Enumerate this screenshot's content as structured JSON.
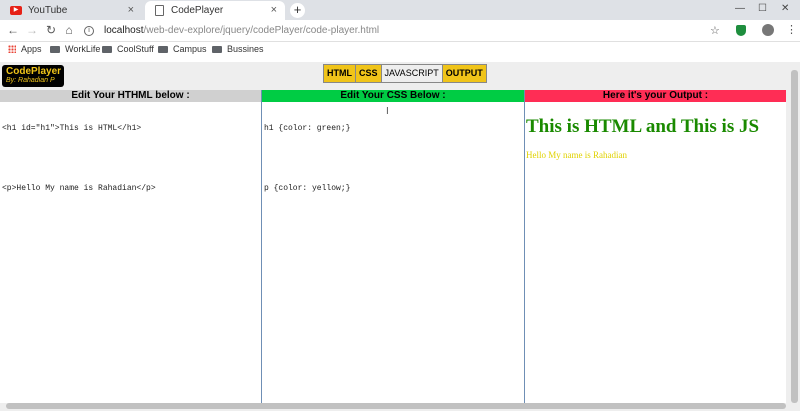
{
  "browser": {
    "tabs": [
      {
        "title": "YouTube",
        "icon": "youtube-icon",
        "active": false
      },
      {
        "title": "CodePlayer",
        "icon": "document-icon",
        "active": true
      }
    ],
    "url_host": "localhost",
    "url_path": "/web-dev-explore/jquery/codePlayer/code-player.html",
    "bookmarks": [
      "Apps",
      "WorkLife",
      "CoolStuff",
      "Campus",
      "Bussines"
    ]
  },
  "app": {
    "logo_title": "CodePlayer",
    "logo_sub": "By: Rahadian P",
    "toggles": [
      {
        "label": "HTML",
        "active": true
      },
      {
        "label": "CSS",
        "active": true
      },
      {
        "label": "JAVASCRIPT",
        "active": false
      },
      {
        "label": "OUTPUT",
        "active": true
      }
    ],
    "panels": {
      "html": {
        "header": "Edit Your HTHML below :",
        "lines": [
          "<h1 id=\"h1\">This is HTML</h1>",
          "",
          "<p>Hello My name is Rahadian</p>"
        ]
      },
      "css": {
        "header": "Edit Your CSS Below :",
        "lines": [
          "h1 {color: green;}",
          "",
          "p {color: yellow;}"
        ]
      },
      "output": {
        "header": "Here it's your Output :",
        "h1": "This is HTML and This is JS",
        "p": "Hello My name is Rahadian"
      }
    },
    "colors": {
      "html_header": "#d0d0d0",
      "css_header": "#00cc44",
      "output_header": "#ff2d55",
      "toggle_active": "#f0c419"
    }
  }
}
